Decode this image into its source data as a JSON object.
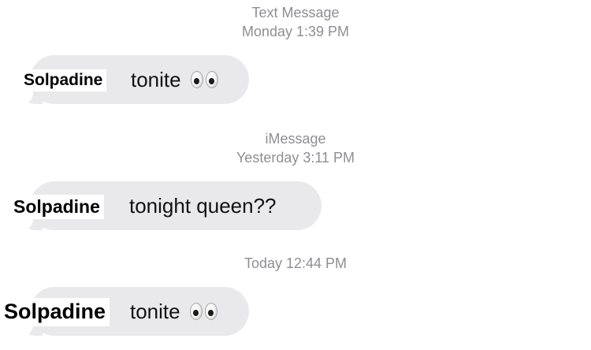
{
  "thread": {
    "stamps": [
      {
        "service": "Text Message",
        "time": "Monday 1:39 PM"
      },
      {
        "service": "iMessage",
        "time": "Yesterday 3:11 PM"
      },
      {
        "service": "",
        "time": "Today 12:44 PM"
      }
    ],
    "messages": [
      {
        "sender_overlay": "Solpadine",
        "text": "tonite",
        "emoji": "eyes-icon"
      },
      {
        "sender_overlay": "Solpadine",
        "text": "tonight queen??",
        "emoji": ""
      },
      {
        "sender_overlay": "Solpadine",
        "text": "tonite",
        "emoji": "eyes-icon"
      }
    ]
  },
  "colors": {
    "bubble_received": "#e9e9eb",
    "timestamp": "#8e8e93",
    "overlay_label_bg": "#ffffff"
  }
}
